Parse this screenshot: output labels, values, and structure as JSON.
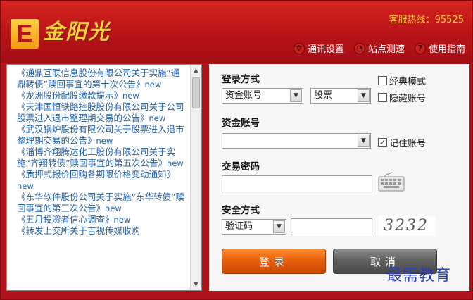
{
  "header": {
    "logo_letter": "E",
    "brand_name": "金阳光",
    "hotline": "客服热线：95525",
    "links": [
      {
        "label": "通讯设置",
        "icon": "gear-icon"
      },
      {
        "label": "站点测速",
        "icon": "speed-icon"
      },
      {
        "label": "使用指南",
        "icon": "help-icon"
      }
    ]
  },
  "news": [
    {
      "title": "《通鼎互联信息股份有限公司关于实施“通鼎转债”赎回事宜的第十次公告》",
      "tag": "new"
    },
    {
      "title": "《龙洲股份配股缴款提示》",
      "tag": "new"
    },
    {
      "title": "《天津国恒铁路控股股份有限公司关于公司股票进入退市整理期交易的公告》",
      "tag": "new"
    },
    {
      "title": "《武汉锅炉股份有限公司关于股票进入退市整理期交易的公告》",
      "tag": "new"
    },
    {
      "title": "《淄博齐翔腾达化工股份有限公司关于实施“齐翔转债”赎回事宜的第五次公告》",
      "tag": "new"
    },
    {
      "title": "《质押式报价回购各期限价格变动通知》",
      "tag": "new"
    },
    {
      "title": "《东华软件股份公司关于实施“东华转债”赎回事宜的第三次公告》",
      "tag": "new"
    },
    {
      "title": "《五月投资者信心调查》",
      "tag": "new"
    },
    {
      "title": "《转发上交所关于吉视传媒收购",
      "tag": ""
    }
  ],
  "login": {
    "method_label": "登录方式",
    "method_value": "资金账号",
    "market_value": "股票",
    "classic_mode": "经典模式",
    "hide_account": "隐藏账号",
    "account_label": "资金账号",
    "account_value": "",
    "remember_account": "记住账号",
    "password_label": "交易密码",
    "password_value": "",
    "security_label": "安全方式",
    "security_value": "验证码",
    "captcha_input": "",
    "captcha_text": "3232",
    "login_button": "登录",
    "cancel_button": "取消",
    "checks": {
      "classic": false,
      "hide": false,
      "remember": true
    }
  },
  "watermark": "最需教育",
  "colors": {
    "frame": "#b0141a",
    "link": "#1f5fa8",
    "login": "#e65c0c",
    "cancel": "#5e5e5e"
  }
}
